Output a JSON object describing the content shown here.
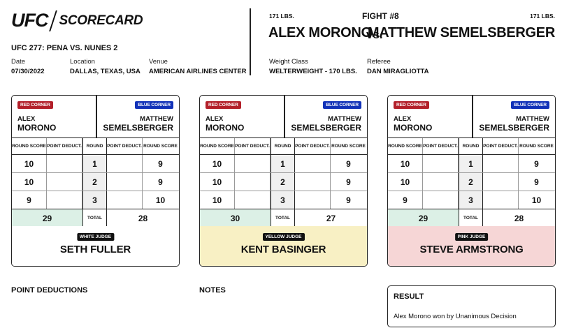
{
  "header": {
    "logo": "UFC",
    "title": "SCORECARD",
    "event": "UFC 277: PENA VS. NUNES 2",
    "date_label": "Date",
    "date": "07/30/2022",
    "location_label": "Location",
    "location": "DALLAS, TEXAS, USA",
    "venue_label": "Venue",
    "venue": "AMERICAN AIRLINES CENTER"
  },
  "fight": {
    "red_weight": "171 LBS.",
    "blue_weight": "171 LBS.",
    "number": "FIGHT #8",
    "red_fighter": "ALEX MORONO",
    "vs": "vs.",
    "blue_fighter": "MATTHEW SEMELSBERGER",
    "weight_class_label": "Weight Class",
    "weight_class": "WELTERWEIGHT - 170 LBS.",
    "referee_label": "Referee",
    "referee": "DAN MIRAGLIOTTA"
  },
  "labels": {
    "red_corner": "RED CORNER",
    "blue_corner": "BLUE CORNER",
    "red_first": "ALEX",
    "red_last": "MORONO",
    "blue_first": "MATTHEW",
    "blue_last": "SEMELSBERGER",
    "round_score": "ROUND SCORE",
    "point_deduct": "POINT DEDUCT.",
    "round": "ROUND",
    "total": "TOTAL"
  },
  "cards": [
    {
      "rounds": [
        {
          "red": "10",
          "red_ded": "",
          "round": "1",
          "blue_ded": "",
          "blue": "9"
        },
        {
          "red": "10",
          "red_ded": "",
          "round": "2",
          "blue_ded": "",
          "blue": "9"
        },
        {
          "red": "9",
          "red_ded": "",
          "round": "3",
          "blue_ded": "",
          "blue": "10"
        }
      ],
      "red_total": "29",
      "blue_total": "28",
      "judge_tag": "WHITE JUDGE",
      "judge_name": "SETH FULLER",
      "judge_color": "#ffffff"
    },
    {
      "rounds": [
        {
          "red": "10",
          "red_ded": "",
          "round": "1",
          "blue_ded": "",
          "blue": "9"
        },
        {
          "red": "10",
          "red_ded": "",
          "round": "2",
          "blue_ded": "",
          "blue": "9"
        },
        {
          "red": "10",
          "red_ded": "",
          "round": "3",
          "blue_ded": "",
          "blue": "9"
        }
      ],
      "red_total": "30",
      "blue_total": "27",
      "judge_tag": "YELLOW JUDGE",
      "judge_name": "KENT BASINGER",
      "judge_color": "#f8f0c4"
    },
    {
      "rounds": [
        {
          "red": "10",
          "red_ded": "",
          "round": "1",
          "blue_ded": "",
          "blue": "9"
        },
        {
          "red": "10",
          "red_ded": "",
          "round": "2",
          "blue_ded": "",
          "blue": "9"
        },
        {
          "red": "9",
          "red_ded": "",
          "round": "3",
          "blue_ded": "",
          "blue": "10"
        }
      ],
      "red_total": "29",
      "blue_total": "28",
      "judge_tag": "PINK JUDGE",
      "judge_name": "STEVE ARMSTRONG",
      "judge_color": "#f6d6d6"
    }
  ],
  "footer": {
    "point_deductions_title": "POINT DEDUCTIONS",
    "notes_title": "NOTES",
    "result_title": "RESULT",
    "result_text": "Alex Morono won by Unanimous Decision"
  },
  "colors": {
    "red_corner": "#b3202a",
    "blue_corner": "#1232b8",
    "red_total_bg": "#dcf0e6"
  }
}
